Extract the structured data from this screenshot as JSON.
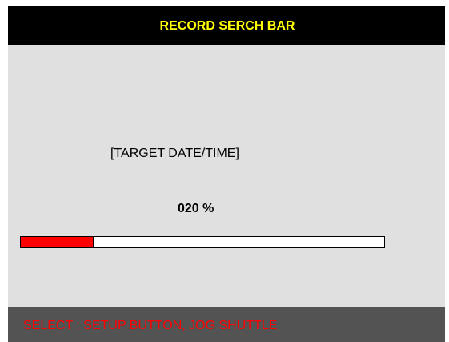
{
  "title_bar": {
    "title": "RECORD SERCH BAR"
  },
  "main": {
    "target_label": "[TARGET DATE/TIME]",
    "progress_text": "020 %",
    "progress_fraction": 0.2
  },
  "status_bar": {
    "hint": "SELECT : SETUP BUTTON, JOG SHUTTLE"
  },
  "colors": {
    "title_bg": "#000000",
    "title_text": "#ffff00",
    "panel_bg": "#e0e0e0",
    "progress_fill": "#ff0000",
    "progress_track": "#ffffff",
    "status_bg": "#535353",
    "status_text": "#ff0000"
  }
}
